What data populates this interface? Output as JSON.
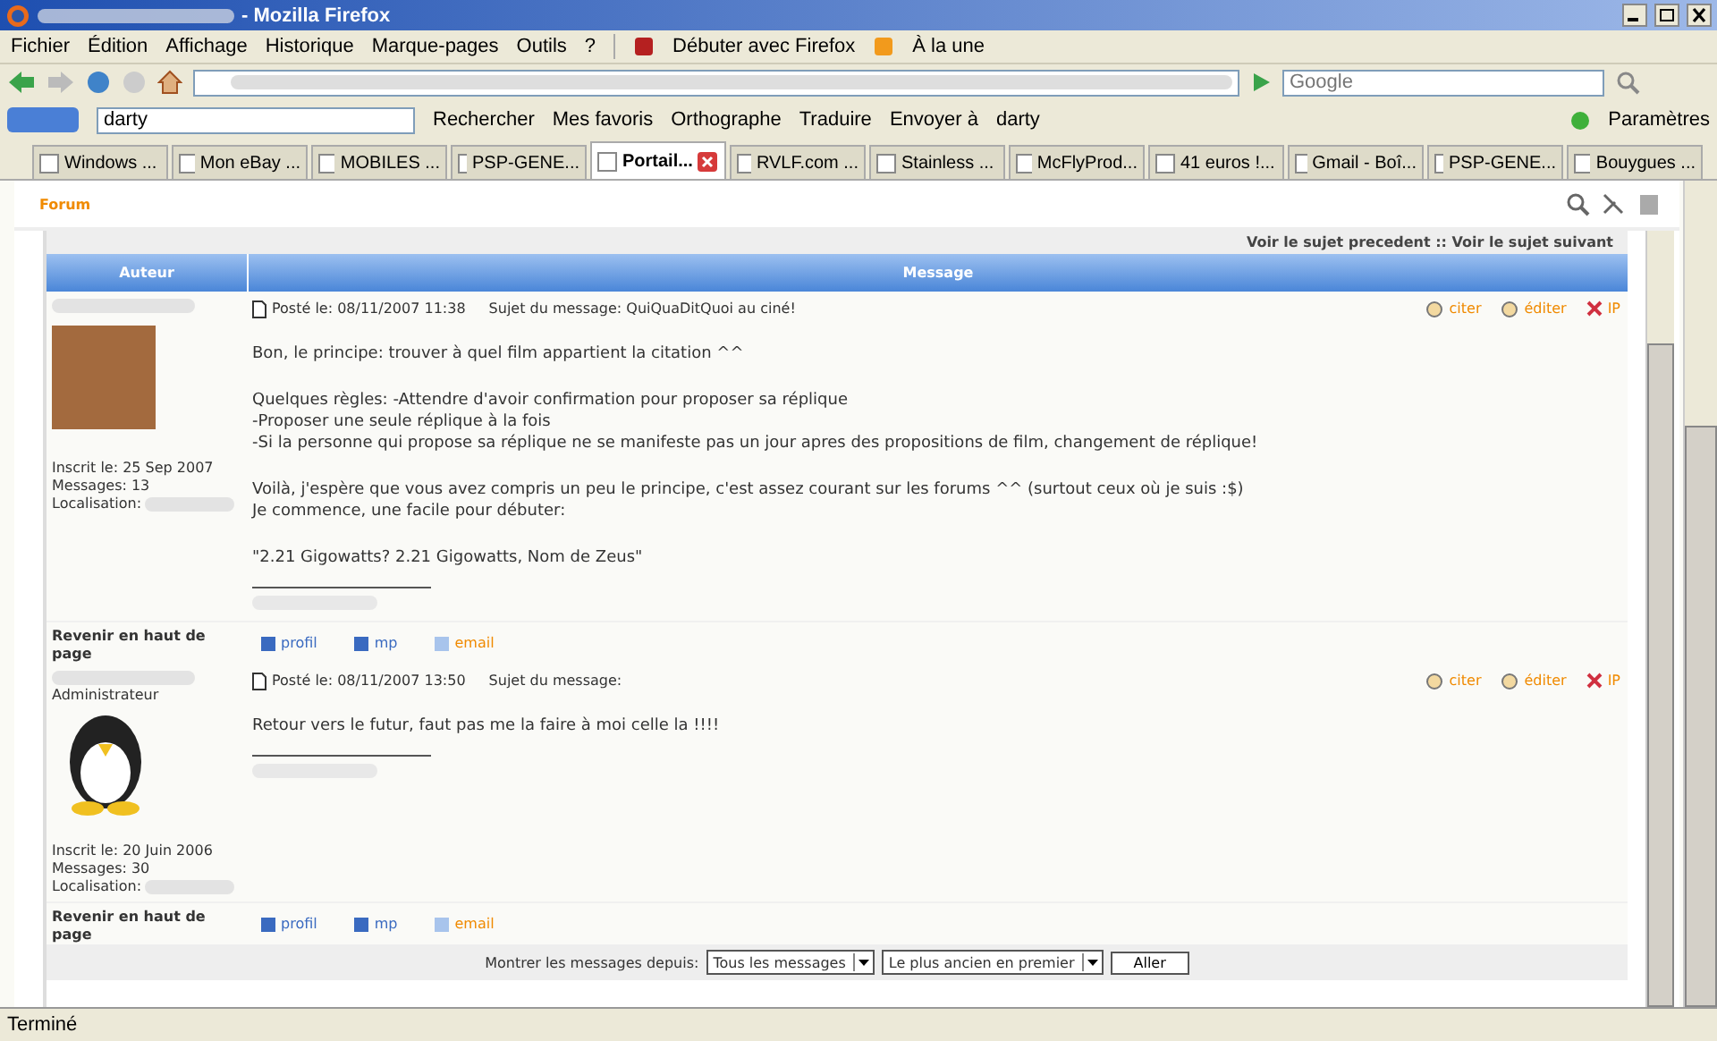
{
  "window": {
    "title": "- Mozilla Firefox"
  },
  "menu": [
    "Fichier",
    "Édition",
    "Affichage",
    "Historique",
    "Marque-pages",
    "Outils",
    "?"
  ],
  "bookmarks": [
    "Débuter avec Firefox",
    "À la une"
  ],
  "search": {
    "placeholder": "Google"
  },
  "google_toolbar": {
    "query": "darty",
    "items": [
      "Rechercher",
      "Mes favoris",
      "Orthographe",
      "Traduire",
      "Envoyer à",
      "darty"
    ],
    "settings": "Paramètres"
  },
  "tabs": [
    {
      "label": "Windows ...",
      "selected": false
    },
    {
      "label": "Mon eBay ...",
      "selected": false
    },
    {
      "label": "MOBILES ...",
      "selected": false
    },
    {
      "label": "PSP-GENE...",
      "selected": false
    },
    {
      "label": "Portail...",
      "selected": true
    },
    {
      "label": "RVLF.com ...",
      "selected": false
    },
    {
      "label": "Stainless ...",
      "selected": false
    },
    {
      "label": "McFlyProd...",
      "selected": false
    },
    {
      "label": "41 euros !...",
      "selected": false
    },
    {
      "label": "Gmail - Boî...",
      "selected": false
    },
    {
      "label": "PSP-GENE...",
      "selected": false
    },
    {
      "label": "Bouygues ...",
      "selected": false
    }
  ],
  "forum": {
    "title": "Forum",
    "topic_nav": "Voir le sujet precedent :: Voir le sujet suivant",
    "columns": [
      "Auteur",
      "Message"
    ],
    "posts": [
      {
        "avatar": {
          "kind": "photo"
        },
        "joined": "Inscrit le: 25 Sep 2007",
        "messages": "Messages: 13",
        "location": "Localisation:",
        "posted": "Posté le: 08/11/2007 11:38",
        "subject": "Sujet du message: QuiQuaDitQuoi au ciné!",
        "actions": [
          "citer",
          "éditer",
          "IP"
        ],
        "paragraphs": [
          [
            "Bon, le principe: trouver à quel film appartient la citation ^^"
          ],
          [
            "Quelques règles: -Attendre d'avoir confirmation pour proposer sa réplique",
            "-Proposer une seule réplique à la fois",
            "-Si la personne qui propose sa réplique ne se manifeste pas un jour apres des propositions de film, changement de réplique!"
          ],
          [
            "Voilà, j'espère que vous avez compris un peu le principe, c'est assez courant sur les forums ^^ (surtout ceux où je suis :$)",
            "Je commence, une facile pour débuter:"
          ],
          [
            "\"2.21 Gigowatts? 2.21 Gigowatts, Nom de Zeus\""
          ]
        ],
        "back": "Revenir en haut de page",
        "links": [
          "profil",
          "mp",
          "email"
        ]
      },
      {
        "rank": "Administrateur",
        "avatar": {
          "kind": "penguin"
        },
        "joined": "Inscrit le: 20 Juin 2006",
        "messages": "Messages: 30",
        "location": "Localisation:",
        "posted": "Posté le: 08/11/2007 13:50",
        "subject": "Sujet du message:",
        "actions": [
          "citer",
          "éditer",
          "IP"
        ],
        "paragraphs": [
          [
            "Retour vers le futur, faut pas me la faire à moi celle la !!!!"
          ]
        ],
        "back": "Revenir en haut de page",
        "links": [
          "profil",
          "mp",
          "email"
        ]
      }
    ],
    "footer": {
      "label": "Montrer les messages depuis:",
      "period": "Tous les messages",
      "order": "Le plus ancien en premier",
      "button": "Aller"
    }
  },
  "status_bar": "Terminé"
}
